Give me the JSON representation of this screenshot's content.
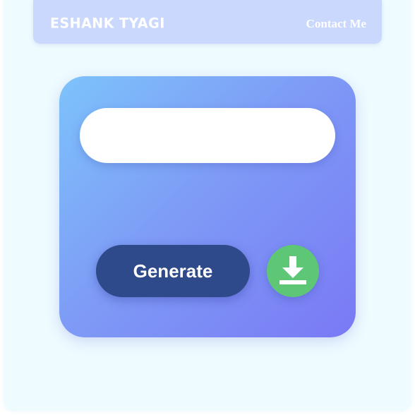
{
  "navbar": {
    "brand": "ESHANK TYAGI",
    "contact_label": "Contact Me"
  },
  "generator": {
    "input_value": "",
    "input_placeholder": "",
    "generate_label": "Generate",
    "download_icon": "download-icon"
  },
  "colors": {
    "page_background": "#eefbff",
    "navbar_background": "#cbd8fd",
    "card_gradient_start": "#7dc3fb",
    "card_gradient_end": "#7a79f5",
    "generate_button": "#2f4a8a",
    "download_button": "#5ec775"
  }
}
